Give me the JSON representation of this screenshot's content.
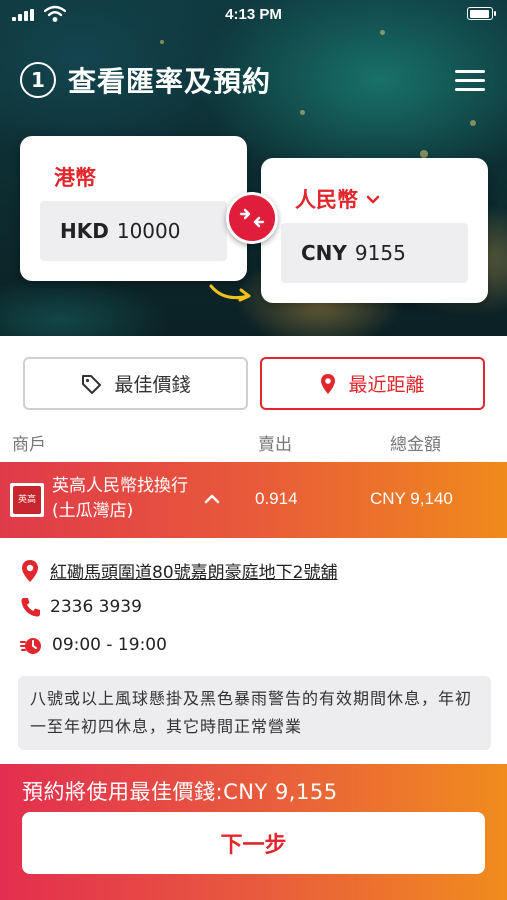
{
  "status_bar": {
    "time": "4:13 PM"
  },
  "header": {
    "step_number": "1",
    "title": "查看匯率及預約"
  },
  "converter": {
    "from": {
      "label": "港幣",
      "currency": "HKD",
      "amount": "10000"
    },
    "to": {
      "label": "人民幣",
      "currency": "CNY",
      "amount": "9155"
    }
  },
  "sort": {
    "best_price_label": "最佳價錢",
    "nearest_label": "最近距離",
    "selected": "nearest"
  },
  "columns": {
    "merchant": "商戶",
    "sell": "賣出",
    "total": "總金額"
  },
  "merchant": {
    "logo_text": "英高",
    "name": "英高人民幣找換行(土瓜灣店)",
    "sell_rate": "0.914",
    "total": "CNY 9,140",
    "address": "紅磡馬頭圍道80號嘉朗豪庭地下2號舖",
    "phone": "2336 3939",
    "hours": "09:00 - 19:00",
    "notice": "八號或以上風球懸掛及黑色暴雨警告的有效期間休息，年初一至年初四休息，其它時間正常營業"
  },
  "footer": {
    "reserve_text": "預約將使用最佳價錢:CNY 9,155",
    "next_label": "下一步"
  },
  "colors": {
    "accent_red": "#e1262d",
    "gradient_start": "#e32e4f",
    "gradient_end": "#f08c1e"
  }
}
